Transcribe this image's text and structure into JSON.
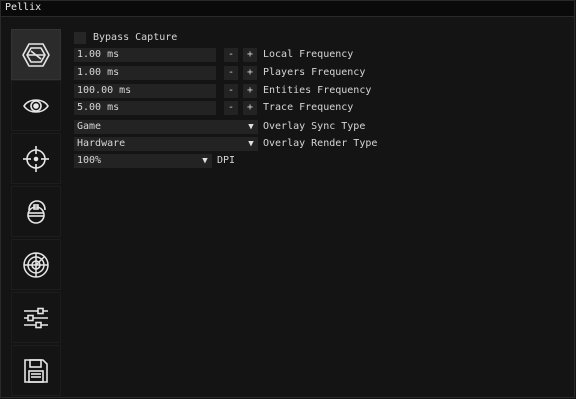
{
  "window": {
    "title": "Pellix"
  },
  "sidebar": {
    "tabs": [
      {
        "icon": "hexagon-logo-icon",
        "active": true
      },
      {
        "icon": "eye-icon",
        "active": false
      },
      {
        "icon": "crosshair-icon",
        "active": false
      },
      {
        "icon": "grenade-icon",
        "active": false
      },
      {
        "icon": "radar-icon",
        "active": false
      },
      {
        "icon": "sliders-icon",
        "active": false
      },
      {
        "icon": "floppy-disk-icon",
        "active": false
      }
    ]
  },
  "settings": {
    "bypass_capture": {
      "label": "Bypass Capture",
      "checked": false
    },
    "frequencies": [
      {
        "value": "1.00 ms",
        "label": "Local Frequency",
        "minus": "-",
        "plus": "+"
      },
      {
        "value": "1.00 ms",
        "label": "Players Frequency",
        "minus": "-",
        "plus": "+"
      },
      {
        "value": "100.00 ms",
        "label": "Entities Frequency",
        "minus": "-",
        "plus": "+"
      },
      {
        "value": "5.00 ms",
        "label": "Trace Frequency",
        "minus": "-",
        "plus": "+"
      }
    ],
    "overlay_sync": {
      "value": "Game",
      "label": "Overlay Sync Type"
    },
    "overlay_render": {
      "value": "Hardware",
      "label": "Overlay Render Type"
    },
    "dpi": {
      "value": "100%",
      "label": "DPI"
    },
    "dropdown_arrow": "▼"
  },
  "colors": {
    "background": "#141414",
    "field": "#232323",
    "active_tab": "#2b2b2b",
    "text": "#d6d6d6"
  }
}
